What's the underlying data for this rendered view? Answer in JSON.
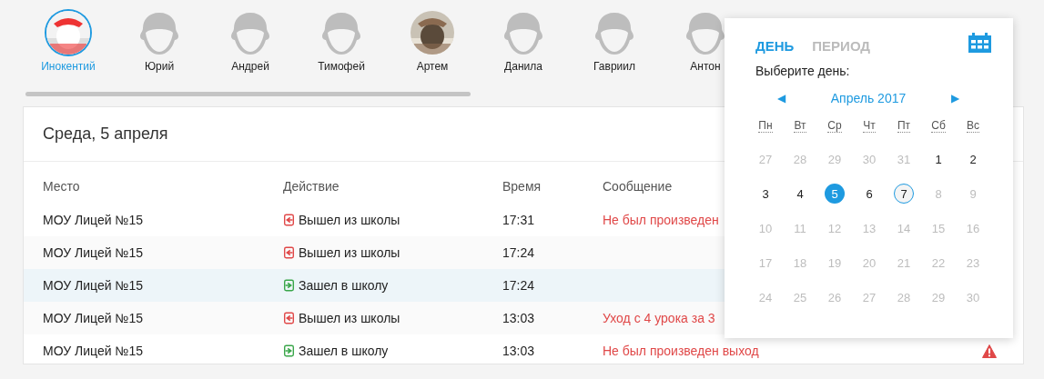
{
  "people": [
    {
      "name": "Инокентий",
      "kind": "picture",
      "selected": true
    },
    {
      "name": "Юрий",
      "kind": "placeholder",
      "selected": false
    },
    {
      "name": "Андрей",
      "kind": "placeholder",
      "selected": false
    },
    {
      "name": "Тимофей",
      "kind": "placeholder",
      "selected": false
    },
    {
      "name": "Артем",
      "kind": "picture",
      "selected": false
    },
    {
      "name": "Данила",
      "kind": "placeholder",
      "selected": false
    },
    {
      "name": "Гавриил",
      "kind": "placeholder",
      "selected": false
    },
    {
      "name": "Антон",
      "kind": "placeholder",
      "selected": false
    }
  ],
  "journal": {
    "title": "Среда, 5 апреля",
    "columns": [
      "Место",
      "Действие",
      "Время",
      "Сообщение"
    ],
    "rows": [
      {
        "place": "МОУ Лицей №15",
        "action": {
          "kind": "exit",
          "label": "Вышел из школы"
        },
        "time": "17:31",
        "message": "Не был произведен",
        "selected": false
      },
      {
        "place": "МОУ Лицей №15",
        "action": {
          "kind": "exit",
          "label": "Вышел из школы"
        },
        "time": "17:24",
        "selected": false
      },
      {
        "place": "МОУ Лицей №15",
        "action": {
          "kind": "enter",
          "label": "Зашел в школу"
        },
        "time": "17:24",
        "selected": true
      },
      {
        "place": "МОУ Лицей №15",
        "action": {
          "kind": "exit",
          "label": "Вышел из школы"
        },
        "time": "13:03",
        "message": "Уход с 4 урока за 3",
        "selected": false
      },
      {
        "place": "МОУ Лицей №15",
        "action": {
          "kind": "enter",
          "label": "Зашел в школу"
        },
        "time": "13:03",
        "message": "Не был произведен выход",
        "warning": true,
        "selected": false
      }
    ]
  },
  "date_picker": {
    "tabs": [
      {
        "label": "ДЕНЬ",
        "selected": true
      },
      {
        "label": "ПЕРИОД",
        "selected": false
      }
    ],
    "prompt": "Выберите день:",
    "prev": "◀",
    "next": "▶",
    "month": "Апрель 2017",
    "weekdays": [
      "Пн",
      "Вт",
      "Ср",
      "Чт",
      "Пт",
      "Сб",
      "Вс"
    ],
    "days": [
      {
        "label": "27",
        "disabled": true,
        "selected": false,
        "today": false
      },
      {
        "label": "28",
        "disabled": true,
        "selected": false,
        "today": false
      },
      {
        "label": "29",
        "disabled": true,
        "selected": false,
        "today": false
      },
      {
        "label": "30",
        "disabled": true,
        "selected": false,
        "today": false
      },
      {
        "label": "31",
        "disabled": true,
        "selected": false,
        "today": false
      },
      {
        "label": "1",
        "disabled": false,
        "selected": false,
        "today": false
      },
      {
        "label": "2",
        "disabled": false,
        "selected": false,
        "today": false
      },
      {
        "label": "3",
        "disabled": false,
        "selected": false,
        "today": false
      },
      {
        "label": "4",
        "disabled": false,
        "selected": false,
        "today": false
      },
      {
        "label": "5",
        "disabled": false,
        "selected": true,
        "today": false
      },
      {
        "label": "6",
        "disabled": false,
        "selected": false,
        "today": false
      },
      {
        "label": "7",
        "disabled": false,
        "selected": false,
        "today": true
      },
      {
        "label": "8",
        "disabled": true,
        "selected": false,
        "today": false
      },
      {
        "label": "9",
        "disabled": true,
        "selected": false,
        "today": false
      },
      {
        "label": "10",
        "disabled": true,
        "selected": false,
        "today": false
      },
      {
        "label": "11",
        "disabled": true,
        "selected": false,
        "today": false
      },
      {
        "label": "12",
        "disabled": true,
        "selected": false,
        "today": false
      },
      {
        "label": "13",
        "disabled": true,
        "selected": false,
        "today": false
      },
      {
        "label": "14",
        "disabled": true,
        "selected": false,
        "today": false
      },
      {
        "label": "15",
        "disabled": true,
        "selected": false,
        "today": false
      },
      {
        "label": "16",
        "disabled": true,
        "selected": false,
        "today": false
      },
      {
        "label": "17",
        "disabled": true,
        "selected": false,
        "today": false
      },
      {
        "label": "18",
        "disabled": true,
        "selected": false,
        "today": false
      },
      {
        "label": "19",
        "disabled": true,
        "selected": false,
        "today": false
      },
      {
        "label": "20",
        "disabled": true,
        "selected": false,
        "today": false
      },
      {
        "label": "21",
        "disabled": true,
        "selected": false,
        "today": false
      },
      {
        "label": "22",
        "disabled": true,
        "selected": false,
        "today": false
      },
      {
        "label": "23",
        "disabled": true,
        "selected": false,
        "today": false
      },
      {
        "label": "24",
        "disabled": true,
        "selected": false,
        "today": false
      },
      {
        "label": "25",
        "disabled": true,
        "selected": false,
        "today": false
      },
      {
        "label": "26",
        "disabled": true,
        "selected": false,
        "today": false
      },
      {
        "label": "27",
        "disabled": true,
        "selected": false,
        "today": false
      },
      {
        "label": "28",
        "disabled": true,
        "selected": false,
        "today": false
      },
      {
        "label": "29",
        "disabled": true,
        "selected": false,
        "today": false
      },
      {
        "label": "30",
        "disabled": true,
        "selected": false,
        "today": false
      }
    ]
  }
}
